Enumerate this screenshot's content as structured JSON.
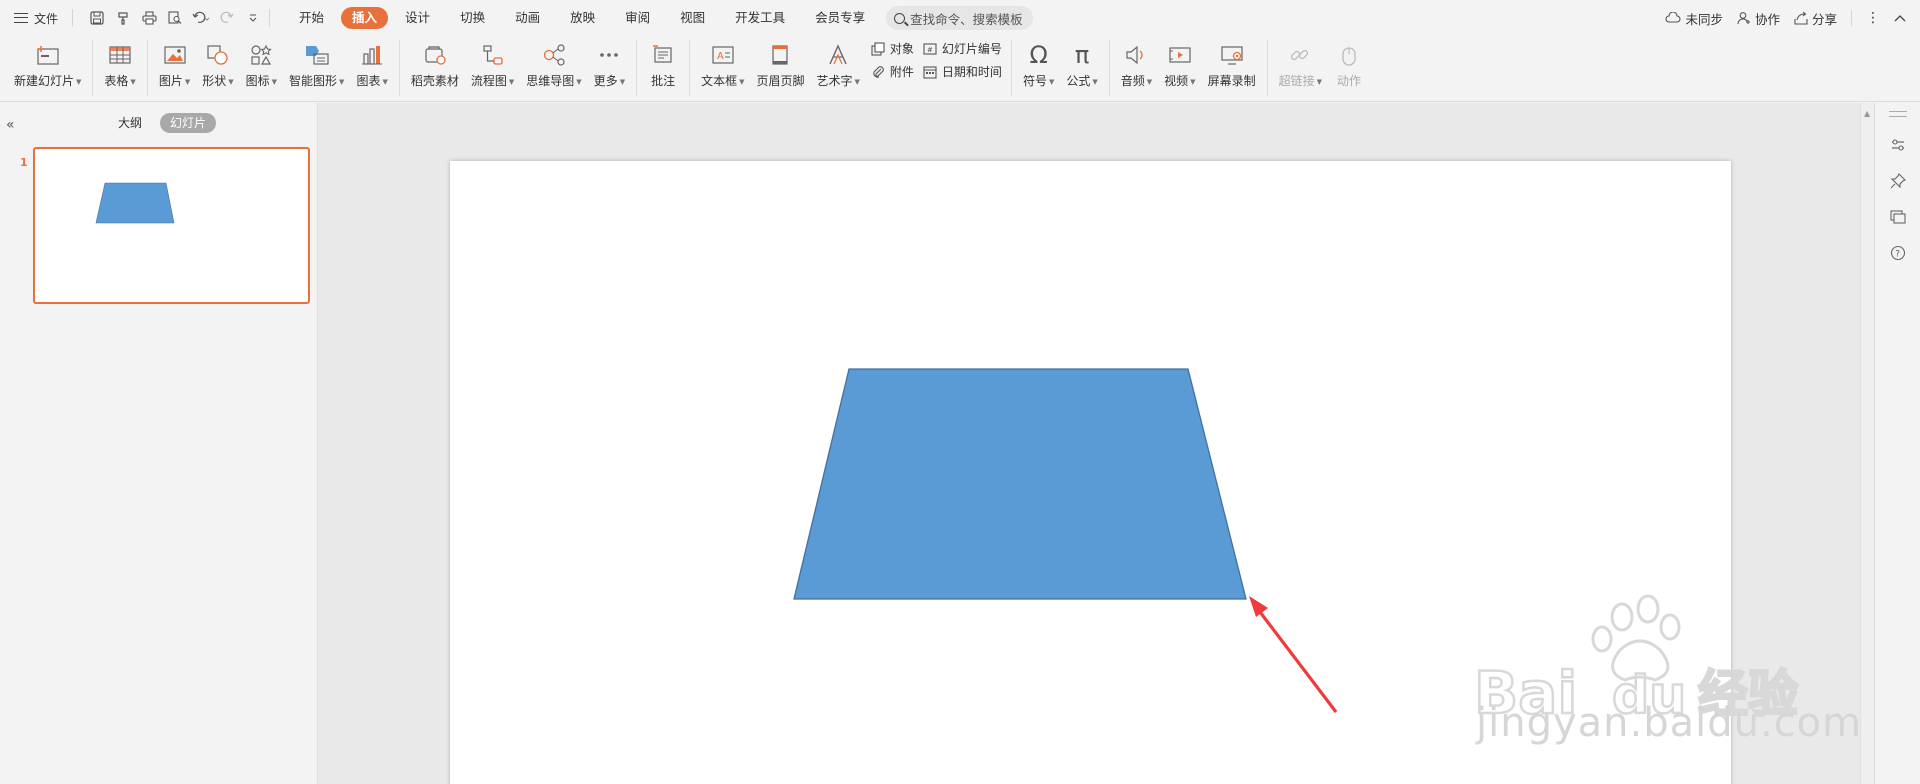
{
  "menubar": {
    "file_label": "文件",
    "tabs": [
      {
        "label": "开始",
        "active": false
      },
      {
        "label": "插入",
        "active": true
      },
      {
        "label": "设计",
        "active": false
      },
      {
        "label": "切换",
        "active": false
      },
      {
        "label": "动画",
        "active": false
      },
      {
        "label": "放映",
        "active": false
      },
      {
        "label": "审阅",
        "active": false
      },
      {
        "label": "视图",
        "active": false
      },
      {
        "label": "开发工具",
        "active": false
      },
      {
        "label": "会员专享",
        "active": false
      }
    ],
    "search_label": "查找命令、搜索模板",
    "sync_label": "未同步",
    "collab_label": "协作",
    "share_label": "分享"
  },
  "ribbon": {
    "new_slide": "新建幻灯片",
    "table": "表格",
    "picture": "图片",
    "shape": "形状",
    "icon": "图标",
    "smartart": "智能图形",
    "chart": "图表",
    "daoke": "稻壳素材",
    "flowchart": "流程图",
    "mindmap": "思维导图",
    "more": "更多",
    "comment": "批注",
    "textbox": "文本框",
    "header_footer": "页眉页脚",
    "wordart": "艺术字",
    "object": "对象",
    "slide_number": "幻灯片编号",
    "attachment": "附件",
    "datetime": "日期和时间",
    "symbol": "符号",
    "formula": "公式",
    "audio": "音频",
    "video": "视频",
    "screen_record": "屏幕录制",
    "hyperlink": "超链接",
    "action": "动作"
  },
  "leftpanel": {
    "outline_label": "大纲",
    "slides_label": "幻灯片",
    "slide_number": "1"
  },
  "colors": {
    "accent": "#e8703a",
    "shape_fill": "#5b9bd5",
    "shape_stroke": "#41719c",
    "arrow": "#ee3b3b"
  },
  "watermark": {
    "sub": "jingyan.baidu.com"
  }
}
